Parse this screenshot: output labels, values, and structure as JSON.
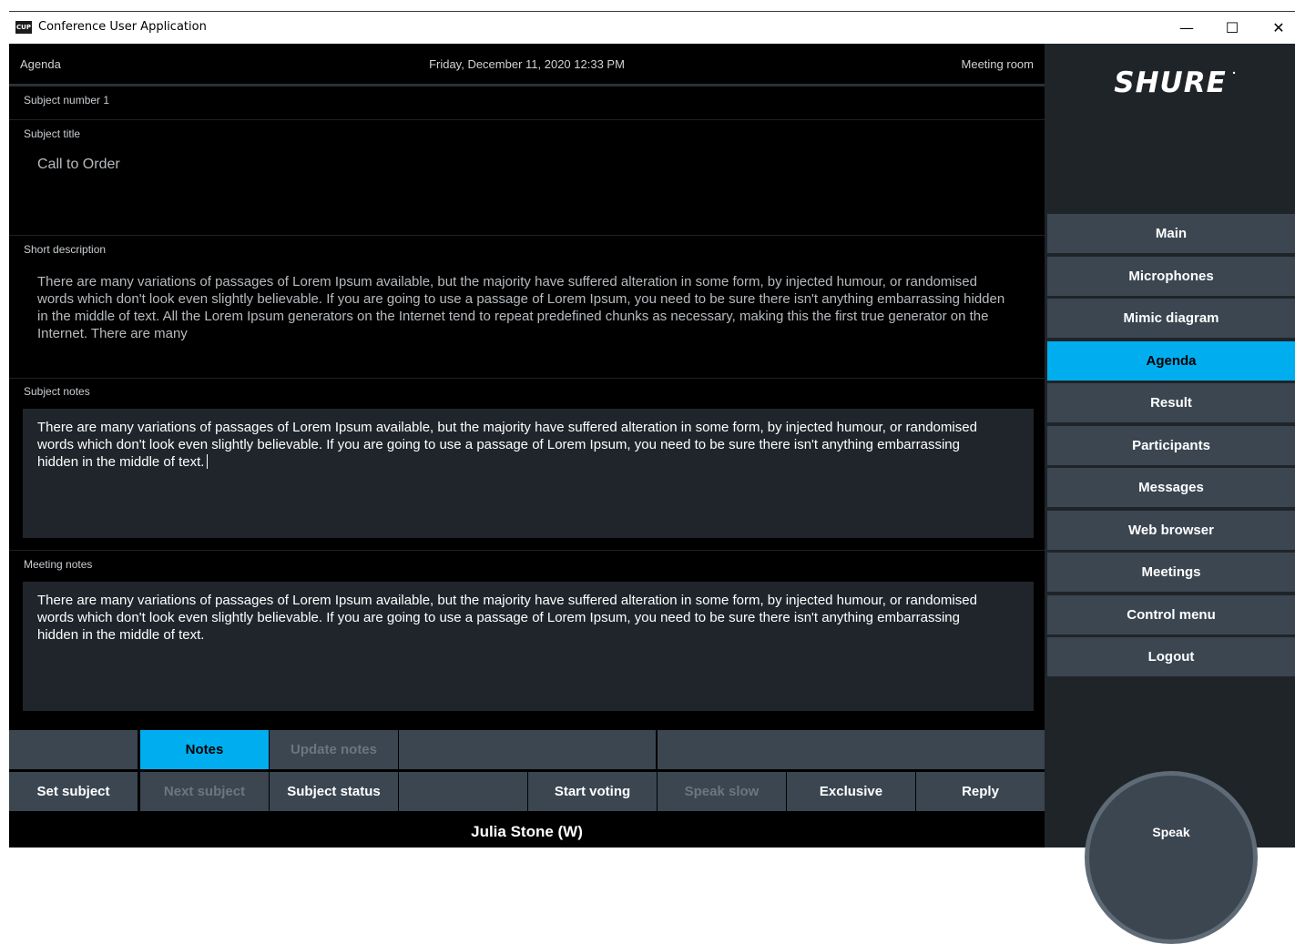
{
  "window": {
    "icon_text": "CUP",
    "title": "Conference User Application",
    "minimize_glyph": "—",
    "maximize_glyph": "☐",
    "close_glyph": "✕"
  },
  "header": {
    "left": "Agenda",
    "center": "Friday, December 11, 2020 12:33 PM",
    "right": "Meeting room"
  },
  "subject_number": {
    "label": "Subject number 1"
  },
  "subject_title": {
    "label": "Subject title",
    "value": "Call to Order"
  },
  "short_description": {
    "label": "Short description",
    "value": "There are many variations of passages of Lorem Ipsum available, but the majority have suffered alteration in some form, by injected humour, or randomised words which don't look even slightly believable. If you are going to use a passage of Lorem Ipsum, you need to be sure there isn't anything embarrassing hidden in the middle of text. All the Lorem Ipsum generators on the Internet tend to repeat predefined chunks as necessary, making this the first true generator on the Internet. There are many"
  },
  "subject_notes": {
    "label": "Subject notes",
    "value": "There are many variations of passages of Lorem Ipsum available, but the majority have suffered alteration in some form, by injected humour, or randomised words which don't look even slightly believable. If you are going to use a passage of Lorem Ipsum, you need to be sure there isn't anything embarrassing hidden in the middle of text."
  },
  "meeting_notes": {
    "label": "Meeting notes",
    "value": "There are many variations of passages of Lorem Ipsum available, but the majority have suffered alteration in some form, by injected humour, or randomised words which don't look even slightly believable. If you are going to use a passage of Lorem Ipsum, you need to be sure there isn't anything embarrassing hidden in the middle of text."
  },
  "toolbar_top": {
    "notes": "Notes",
    "update_notes": "Update notes"
  },
  "toolbar_bottom": {
    "set_subject": "Set subject",
    "next_subject": "Next subject",
    "subject_status": "Subject status",
    "start_voting": "Start voting",
    "speak_slow": "Speak slow",
    "exclusive": "Exclusive",
    "reply": "Reply"
  },
  "status_bar": {
    "user": "Julia Stone (W)"
  },
  "brand": {
    "logo": "SHURE"
  },
  "nav": {
    "main": "Main",
    "microphones": "Microphones",
    "mimic_diagram": "Mimic diagram",
    "agenda": "Agenda",
    "result": "Result",
    "participants": "Participants",
    "messages": "Messages",
    "web_browser": "Web browser",
    "meetings": "Meetings",
    "control_menu": "Control menu",
    "logout": "Logout"
  },
  "speak_button": {
    "label": "Speak"
  },
  "colors": {
    "accent": "#00aeef",
    "button": "#3b4651",
    "panel": "#1f2429",
    "note_box": "#1f252b"
  }
}
